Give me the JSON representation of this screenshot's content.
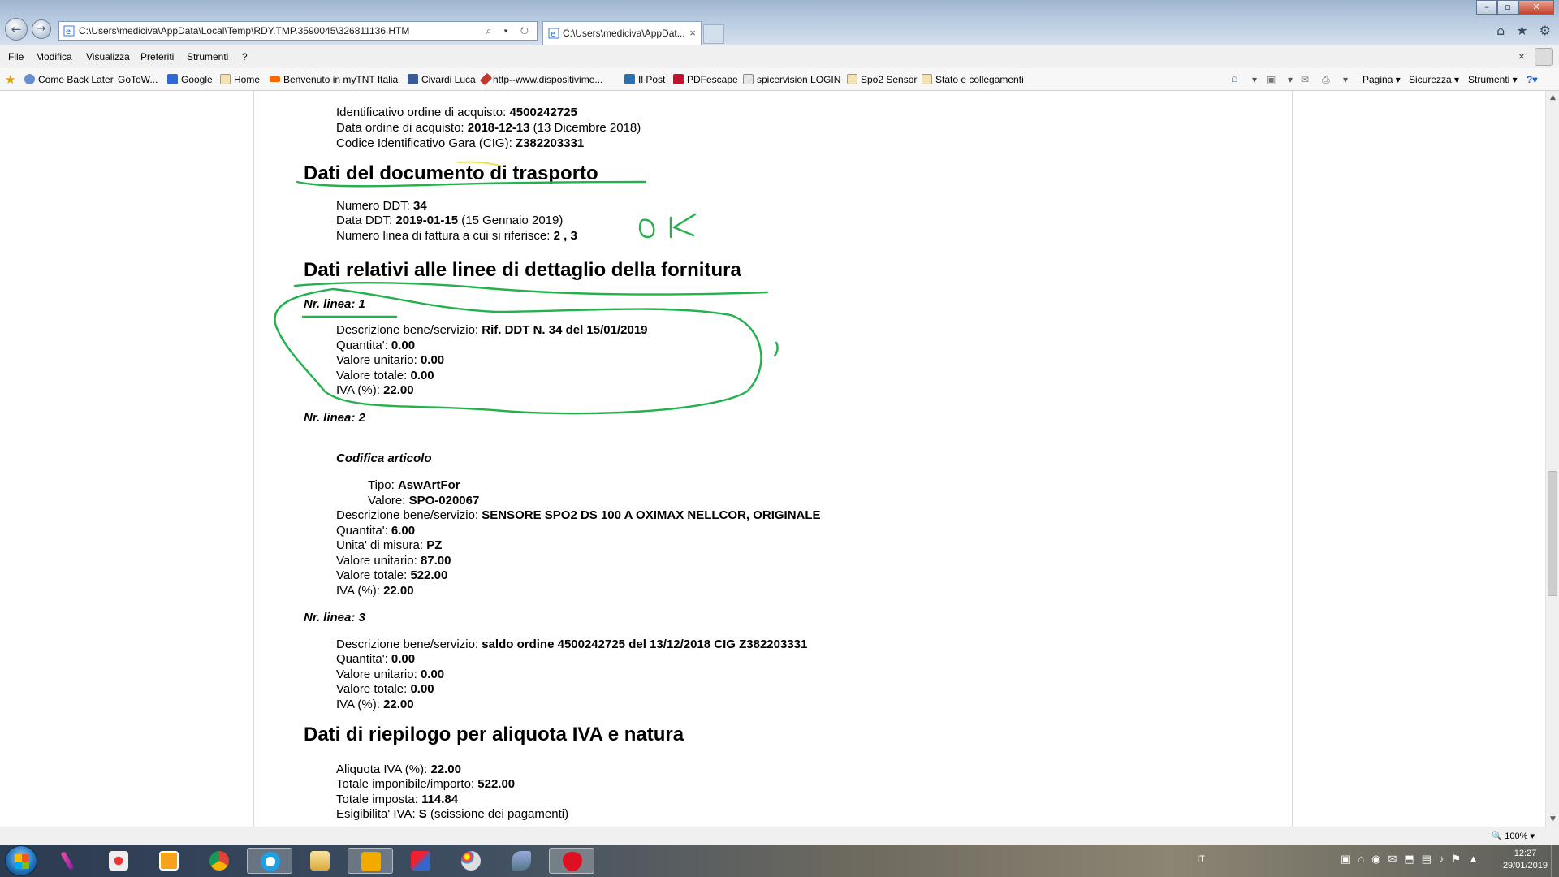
{
  "browser": {
    "address": "C:\\Users\\mediciva\\AppData\\Local\\Temp\\RDY.TMP.3590045\\326811136.HTM",
    "address_tools": "⌕ ▾ ↻",
    "tab_title": "C:\\Users\\mediciva\\AppDat...",
    "tab_close": "×",
    "back": "←",
    "forward": "→",
    "win_min": "–",
    "win_max": "▫",
    "win_close": "✕",
    "home_icon": "⌂",
    "fav_icon": "★",
    "gear_icon": "⚙"
  },
  "menu": [
    "File",
    "Modifica",
    "Visualizza",
    "Preferiti",
    "Strumenti",
    "?"
  ],
  "menu_close": "×",
  "favorites": [
    {
      "label": "Come Back Later",
      "color": "#6a8fd0"
    },
    {
      "label": "GoToW...",
      "color": "#ffffff"
    },
    {
      "label": "Google",
      "color": "#3367d6"
    },
    {
      "label": "Home",
      "color": "#d9b25a"
    },
    {
      "label": "Benvenuto in myTNT Italia",
      "color": "#ff6600"
    },
    {
      "label": "Civardi Luca",
      "color": "#3b5998"
    },
    {
      "label": "http--www.dispositivime...",
      "color": "#c0392b"
    },
    {
      "label": "Il Post",
      "color": "#2a6fb0"
    },
    {
      "label": "PDFescape",
      "color": "#c8102e"
    },
    {
      "label": "spicervision LOGIN",
      "color": "#7a7a7a"
    },
    {
      "label": "Spo2 Sensor",
      "color": "#d9b25a"
    },
    {
      "label": "Stato e collegamenti",
      "color": "#d9b25a"
    }
  ],
  "commands": {
    "page": "Pagina ▾",
    "security": "Sicurezza ▾",
    "tools": "Strumenti ▾",
    "help": "?▾"
  },
  "doc": {
    "ordine": {
      "id_label": "Identificativo ordine di acquisto: ",
      "id_value": "4500242725",
      "data_label": "Data ordine di acquisto: ",
      "data_value": "2018-12-13",
      "data_extra": " (13 Dicembre 2018)",
      "cig_label": "Codice Identificativo Gara (CIG): ",
      "cig_value": "Z382203331"
    },
    "trasporto": {
      "title": "Dati del documento di trasporto",
      "numero_label": "Numero DDT: ",
      "numero_value": "34",
      "data_label": "Data DDT: ",
      "data_value": "2019-01-15",
      "data_extra": " (15 Gennaio 2019)",
      "linea_label": "Numero linea di fattura a cui si riferisce: ",
      "linea_value": "2 , 3"
    },
    "dettaglio_title": "Dati relativi alle linee di dettaglio della fornitura",
    "linee": [
      {
        "nr": "Nr. linea: 1",
        "descr_label": "Descrizione bene/servizio: ",
        "descr_value": "Rif. DDT N. 34 del 15/01/2019",
        "qta_label": "Quantita': ",
        "qta_value": "0.00",
        "vu_label": "Valore unitario: ",
        "vu_value": "0.00",
        "vt_label": "Valore totale: ",
        "vt_value": "0.00",
        "iva_label": "IVA (%): ",
        "iva_value": "22.00"
      },
      {
        "nr": "Nr. linea: 2",
        "codifica_title": "Codifica articolo",
        "tipo_label": "Tipo: ",
        "tipo_value": "AswArtFor",
        "valore_label": "Valore: ",
        "valore_value": "SPO-020067",
        "descr_label": "Descrizione bene/servizio: ",
        "descr_value": "SENSORE SPO2 DS 100 A OXIMAX NELLCOR, ORIGINALE",
        "qta_label": "Quantita': ",
        "qta_value": "6.00",
        "um_label": "Unita' di misura: ",
        "um_value": "PZ",
        "vu_label": "Valore unitario: ",
        "vu_value": "87.00",
        "vt_label": "Valore totale: ",
        "vt_value": "522.00",
        "iva_label": "IVA (%): ",
        "iva_value": "22.00"
      },
      {
        "nr": "Nr. linea: 3",
        "descr_label": "Descrizione bene/servizio: ",
        "descr_value": "saldo ordine 4500242725 del 13/12/2018 CIG Z382203331",
        "qta_label": "Quantita': ",
        "qta_value": "0.00",
        "vu_label": "Valore unitario: ",
        "vu_value": "0.00",
        "vt_label": "Valore totale: ",
        "vt_value": "0.00",
        "iva_label": "IVA (%): ",
        "iva_value": "22.00"
      }
    ],
    "riepilogo": {
      "title": "Dati di riepilogo per aliquota IVA e natura",
      "aliquota_label": "Aliquota IVA (%): ",
      "aliquota_value": "22.00",
      "imponibile_label": "Totale imponibile/importo: ",
      "imponibile_value": "522.00",
      "imposta_label": "Totale imposta: ",
      "imposta_value": "114.84",
      "esigibilita_label": "Esigibilita' IVA: ",
      "esigibilita_value": "S",
      "esigibilita_extra": " (scissione dei pagamenti)"
    },
    "handwriting": "OK",
    "annotation_color": "#22b14c"
  },
  "status": {
    "zoom": "100%"
  },
  "taskbar": {
    "lang": "IT",
    "time": "12:27",
    "date": "29/01/2019"
  }
}
